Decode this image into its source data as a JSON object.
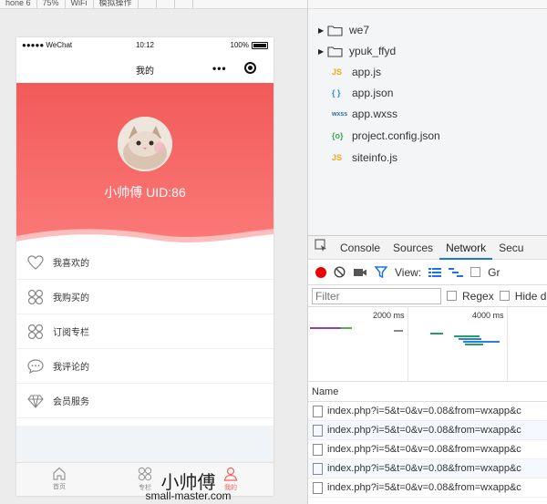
{
  "toolbar": {
    "items": [
      "hone 6",
      "75%",
      "WiFi",
      "模拟操作"
    ]
  },
  "phone": {
    "status": {
      "carrier": "●●●●● WeChat",
      "time": "10:12",
      "battery": "100%"
    },
    "nav_title": "我的",
    "user": {
      "name_uid": "小帅傅 UID:86"
    },
    "menu": [
      {
        "label": "我喜欢的",
        "icon": "heart-icon"
      },
      {
        "label": "我购买的",
        "icon": "grid-petals-icon"
      },
      {
        "label": "订阅专栏",
        "icon": "grid-petals-icon"
      },
      {
        "label": "我评论的",
        "icon": "comment-icon"
      },
      {
        "label": "会员服务",
        "icon": "diamond-icon"
      }
    ],
    "tabs": [
      {
        "label": "首页",
        "icon": "home-icon"
      },
      {
        "label": "专栏",
        "icon": "grid-petals-icon"
      },
      {
        "label": "我的",
        "icon": "user-icon",
        "active": true
      }
    ]
  },
  "files": [
    {
      "name": "we7",
      "type": "folder"
    },
    {
      "name": "ypuk_ffyd",
      "type": "folder"
    },
    {
      "name": "app.js",
      "type": "js",
      "badge": "JS"
    },
    {
      "name": "app.json",
      "type": "json",
      "badge": "{ }"
    },
    {
      "name": "app.wxss",
      "type": "wxss",
      "badge": "wxss"
    },
    {
      "name": "project.config.json",
      "type": "config",
      "badge": "{o}"
    },
    {
      "name": "siteinfo.js",
      "type": "js",
      "badge": "JS"
    }
  ],
  "devtools": {
    "tabs": [
      "Console",
      "Sources",
      "Network",
      "Secu"
    ],
    "active_tab": "Network",
    "view_label": "View:",
    "group_label": "Gr",
    "filter_placeholder": "Filter",
    "regex_label": "Regex",
    "hide_label": "Hide d",
    "timeline_labels": [
      "2000 ms",
      "4000 ms"
    ],
    "name_header": "Name",
    "requests": [
      "index.php?i=5&t=0&v=0.08&from=wxapp&c",
      "index.php?i=5&t=0&v=0.08&from=wxapp&c",
      "index.php?i=5&t=0&v=0.08&from=wxapp&c",
      "index.php?i=5&t=0&v=0.08&from=wxapp&c",
      "index.php?i=5&t=0&v=0.08&from=wxapp&c"
    ]
  },
  "watermark": {
    "title": "小帅傅",
    "sub": "small-master.com"
  },
  "colors": {
    "accent": "#f15a59",
    "devtools_blue": "#1a73e8"
  }
}
